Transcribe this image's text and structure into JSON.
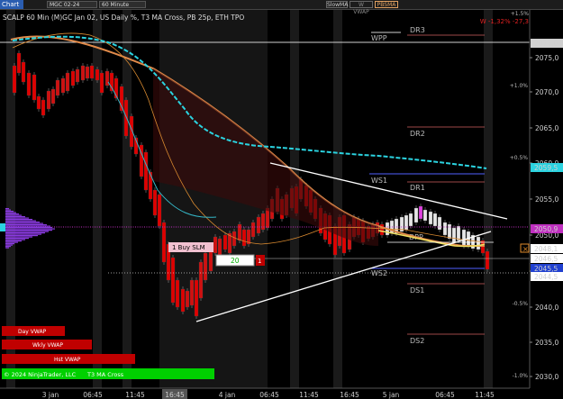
{
  "toolbar": {
    "chart_tab": "Chart",
    "instrument": "MGC 02-24",
    "timeframe": "60 Minute",
    "buttons": [
      "SlowMA",
      "W VWAP",
      "PBSMA"
    ],
    "button_colors": [
      "#cfcfcf",
      "#8a8a8a",
      "#e0a060"
    ]
  },
  "chart": {
    "subtitle": "SCALP 60 Min (M)GC Jan 02, US Daily %, T3 MA Cross, PB 25p, ETH TPO",
    "top_right_status": "W -1,32% -27,3",
    "price_labels": [
      "2075,0",
      "2070,0",
      "2065,0",
      "2060,0",
      "2055,0",
      "2050,0",
      "2045,0",
      "2040,0",
      "2035,0",
      "2030,0"
    ],
    "highlight_prices": [
      {
        "text": "2077,0",
        "bg": "#d0d0d0",
        "fg": "#000"
      },
      {
        "text": "2059,5",
        "bg": "#2bd3e0",
        "fg": "#000"
      },
      {
        "text": "2050,9",
        "bg": "#c030c0",
        "fg": "#fff"
      },
      {
        "text": "2048,1",
        "bg": "#ffffff",
        "fg": "#000"
      },
      {
        "text": "2046,5",
        "bg": "#ffffff",
        "fg": "#000"
      },
      {
        "text": "2045,5",
        "bg": "#2040d0",
        "fg": "#fff"
      },
      {
        "text": "2044,5",
        "bg": "#ffffff",
        "fg": "#000"
      }
    ],
    "pct_labels": [
      "+1.5%",
      "+1.0%",
      "+0.5%",
      "-0.5%",
      "-1.0%"
    ],
    "levels": [
      "WPP",
      "DR3",
      "DR2",
      "WS1",
      "DR1",
      "DPP",
      "WS2",
      "DS1",
      "DS2"
    ],
    "x_labels": [
      "3 jan",
      "06:45",
      "11:45",
      "16:45",
      "4 jan",
      "06:45",
      "11:45",
      "16:45",
      "5 jan",
      "06:45",
      "11:45"
    ],
    "cursor_time": "16:45",
    "vwap_labels": [
      "Day VWAP",
      "Wkly VWAP",
      "Hst VWAP"
    ],
    "copyright": "© 2024 NinjaTrader, LLC",
    "indicator_label": "T3 MA Cross",
    "order": {
      "label": "1 Buy SLM",
      "quantity": "20",
      "count": "1"
    }
  }
}
